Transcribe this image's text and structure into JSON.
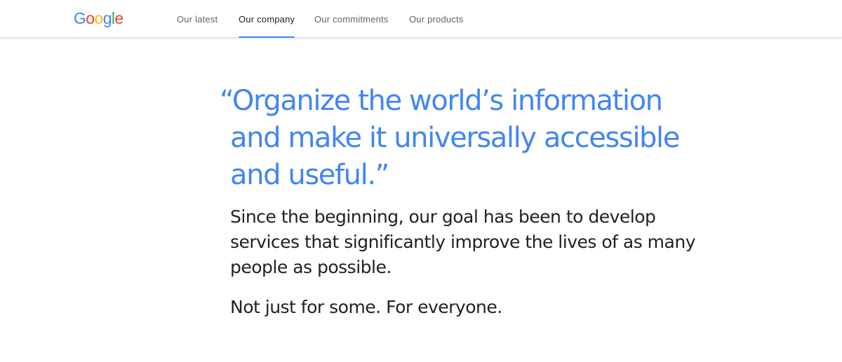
{
  "brand": {
    "logo_letters": [
      {
        "char": "G",
        "color": "#4285F4"
      },
      {
        "char": "o",
        "color": "#EA4335"
      },
      {
        "char": "o",
        "color": "#FBBC05"
      },
      {
        "char": "g",
        "color": "#4285F4"
      },
      {
        "char": "l",
        "color": "#34A853"
      },
      {
        "char": "e",
        "color": "#EA4335"
      }
    ]
  },
  "nav": {
    "items": [
      {
        "label": "Our latest",
        "active": false
      },
      {
        "label": "Our company",
        "active": true
      },
      {
        "label": "Our commitments",
        "active": false
      },
      {
        "label": "Our products",
        "active": false
      }
    ]
  },
  "main": {
    "quote_lines": [
      "“Organize the world’s information",
      "and make it universally accessible",
      "and useful.”"
    ],
    "body_lines": [
      "Since the beginning, our goal has been to develop",
      "services that significantly improve the lives of as many",
      "people as possible."
    ],
    "tagline": "Not just for some. For everyone."
  },
  "colors": {
    "accent_blue": "#4285F4",
    "quote_blue": "#4285F4",
    "nav_text": "#5f6368",
    "nav_active_text": "#202124",
    "body_text": "#202124",
    "header_border": "#dadce0"
  }
}
